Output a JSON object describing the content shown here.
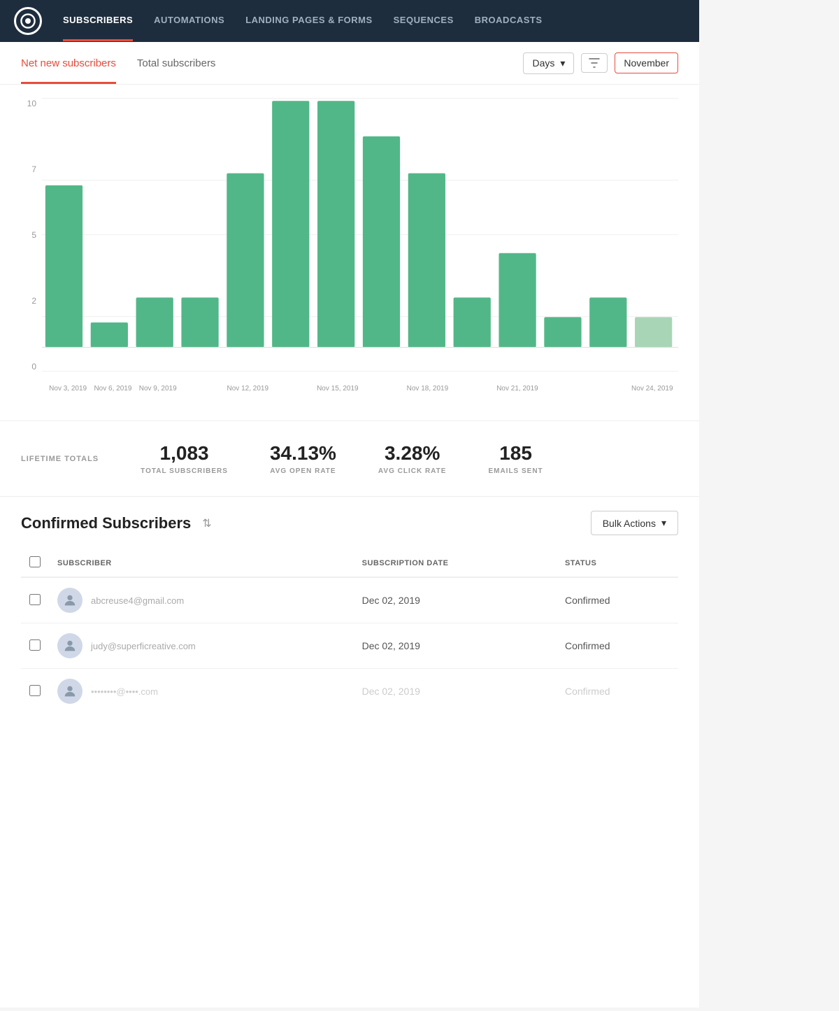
{
  "nav": {
    "items": [
      {
        "label": "SUBSCRIBERS",
        "active": true
      },
      {
        "label": "AUTOMATIONS",
        "active": false
      },
      {
        "label": "LANDING PAGES & FORMS",
        "active": false
      },
      {
        "label": "SEQUENCES",
        "active": false
      },
      {
        "label": "BROADCASTS",
        "active": false
      }
    ]
  },
  "tabs": {
    "items": [
      {
        "label": "Net new subscribers",
        "active": true
      },
      {
        "label": "Total subscribers",
        "active": false
      }
    ],
    "days_label": "Days",
    "date_label": "November"
  },
  "chart": {
    "y_labels": [
      "0",
      "2",
      "5",
      "7",
      "10"
    ],
    "bars": [
      {
        "date": "Nov 3, 2019",
        "value": 6.5,
        "faded": false
      },
      {
        "date": "Nov 6, 2019",
        "value": 1,
        "faded": false
      },
      {
        "date": "Nov 9, 2019",
        "value": 2,
        "faded": false
      },
      {
        "date": "",
        "value": 2,
        "faded": false
      },
      {
        "date": "Nov 12, 2019",
        "value": 7,
        "faded": false
      },
      {
        "date": "",
        "value": 10.2,
        "faded": false
      },
      {
        "date": "Nov 15, 2019",
        "value": 10.2,
        "faded": false
      },
      {
        "date": "",
        "value": 8.5,
        "faded": false
      },
      {
        "date": "Nov 18, 2019",
        "value": 7,
        "faded": false
      },
      {
        "date": "",
        "value": 2,
        "faded": false
      },
      {
        "date": "Nov 21, 2019",
        "value": 3.8,
        "faded": false
      },
      {
        "date": "",
        "value": 1.2,
        "faded": false
      },
      {
        "date": "",
        "value": 2,
        "faded": false
      },
      {
        "date": "Nov 24, 2019",
        "value": 1.2,
        "faded": true
      }
    ],
    "x_labels": [
      "Nov 3, 2019",
      "Nov 6, 2019",
      "Nov 9, 2019",
      "",
      "Nov 12, 2019",
      "",
      "Nov 15, 2019",
      "",
      "Nov 18, 2019",
      "",
      "Nov 21, 2019",
      "",
      "",
      "Nov 24, 2019"
    ]
  },
  "stats": {
    "lifetime_label": "LIFETIME TOTALS",
    "total_subscribers": "1,083",
    "total_subscribers_label": "TOTAL SUBSCRIBERS",
    "avg_open_rate": "34.13%",
    "avg_open_rate_label": "AVG OPEN RATE",
    "avg_click_rate": "3.28%",
    "avg_click_rate_label": "AVG CLICK RATE",
    "emails_sent": "185",
    "emails_sent_label": "EMAILS SENT"
  },
  "subscribers": {
    "title": "Confirmed Subscribers",
    "bulk_actions_label": "Bulk Actions",
    "columns": {
      "subscriber": "SUBSCRIBER",
      "subscription_date": "SUBSCRIPTION DATE",
      "status": "STATUS"
    },
    "rows": [
      {
        "email": "abcreuse4@gmail.com",
        "date": "Dec 02, 2019",
        "status": "Confirmed"
      },
      {
        "email": "judy@superficreative.com",
        "date": "Dec 02, 2019",
        "status": "Confirmed"
      },
      {
        "email": "••••••••@••••.com",
        "date": "Dec 02, 2019",
        "status": "Confirmed"
      }
    ]
  }
}
